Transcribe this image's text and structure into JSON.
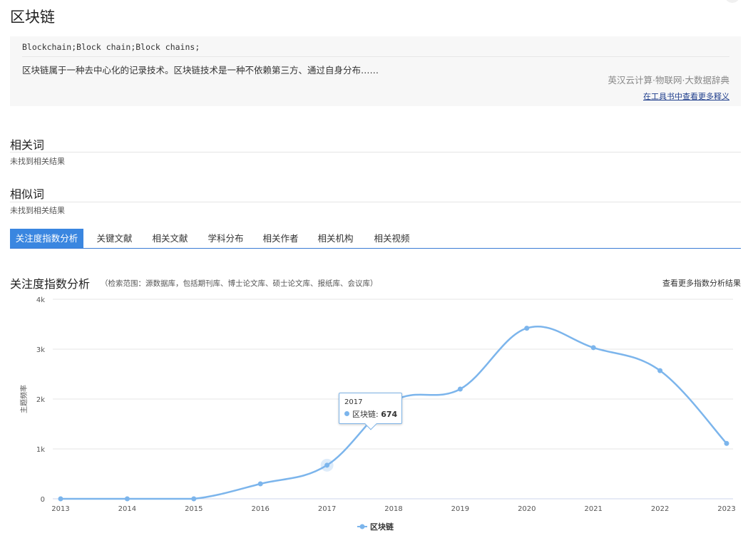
{
  "page": {
    "title": "区块链"
  },
  "definition": {
    "english": "Blockchain;Block chain;Block chains;",
    "text": "区块链属于一种去中心化的记录技术。区块链技术是一种不依赖第三方、通过自身分布……",
    "source": "英汉云计算·物联网·大数据辞典",
    "more_link": "在工具书中查看更多释义"
  },
  "related_words": {
    "title": "相关词",
    "empty": "未找到相关结果"
  },
  "similar_words": {
    "title": "相似词",
    "empty": "未找到相关结果"
  },
  "tabs": [
    "关注度指数分析",
    "关键文献",
    "相关文献",
    "学科分布",
    "相关作者",
    "相关机构",
    "相关视频"
  ],
  "analysis": {
    "title": "关注度指数分析",
    "scope": "（检索范围：源数据库，包括期刊库、博士论文库、硕士论文库、报纸库、会议库）",
    "more_link": "查看更多指数分析结果"
  },
  "chart_data": {
    "type": "line",
    "x": [
      "2013",
      "2014",
      "2015",
      "2016",
      "2017",
      "2018",
      "2019",
      "2020",
      "2021",
      "2022",
      "2023"
    ],
    "series": [
      {
        "name": "区块链",
        "values": [
          0,
          0,
          0,
          300,
          674,
          1960,
          2200,
          3420,
          3030,
          2570,
          1110
        ],
        "color": "#7cb5ec"
      }
    ],
    "ylabel": "主题频率",
    "ylim": [
      0,
      4000
    ],
    "yticks": [
      "0",
      "1k",
      "2k",
      "3k",
      "4k"
    ],
    "grid": true,
    "legend": "bottom",
    "tooltip": {
      "year": "2017",
      "series": "区块链",
      "value": "674"
    }
  }
}
